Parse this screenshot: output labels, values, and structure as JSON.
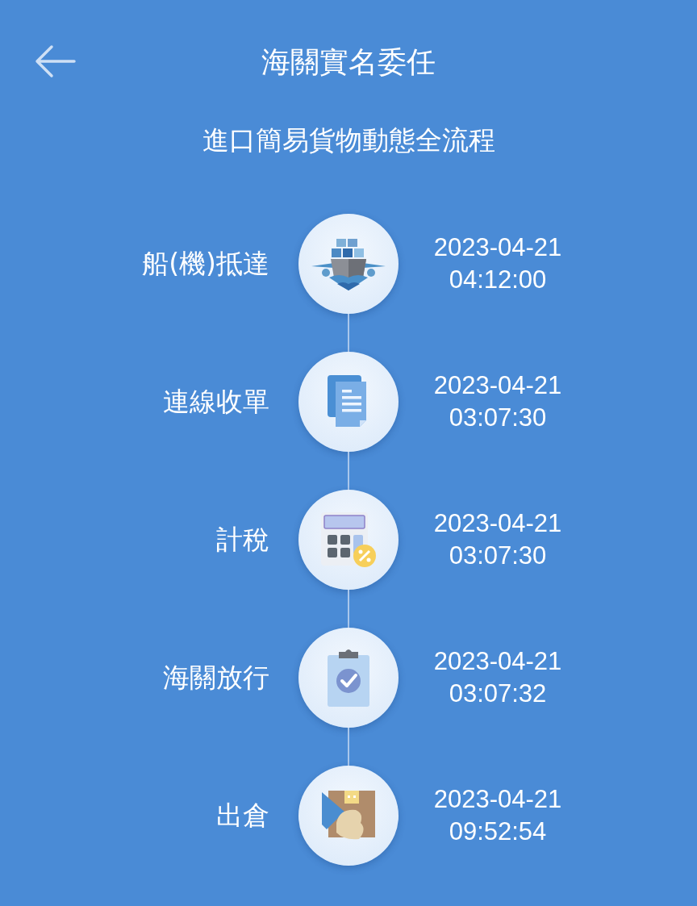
{
  "header": {
    "title": "海關實名委任"
  },
  "subtitle": "進口簡易貨物動態全流程",
  "steps": [
    {
      "label": "船(機)抵達",
      "kind": "ship",
      "date": "2023-04-21",
      "time": "04:12:00"
    },
    {
      "label": "連線收單",
      "kind": "document",
      "date": "2023-04-21",
      "time": "03:07:30"
    },
    {
      "label": "計稅",
      "kind": "calculator",
      "date": "2023-04-21",
      "time": "03:07:30"
    },
    {
      "label": "海關放行",
      "kind": "clipboard",
      "date": "2023-04-21",
      "time": "03:07:32"
    },
    {
      "label": "出倉",
      "kind": "package",
      "date": "2023-04-21",
      "time": "09:52:54"
    }
  ]
}
